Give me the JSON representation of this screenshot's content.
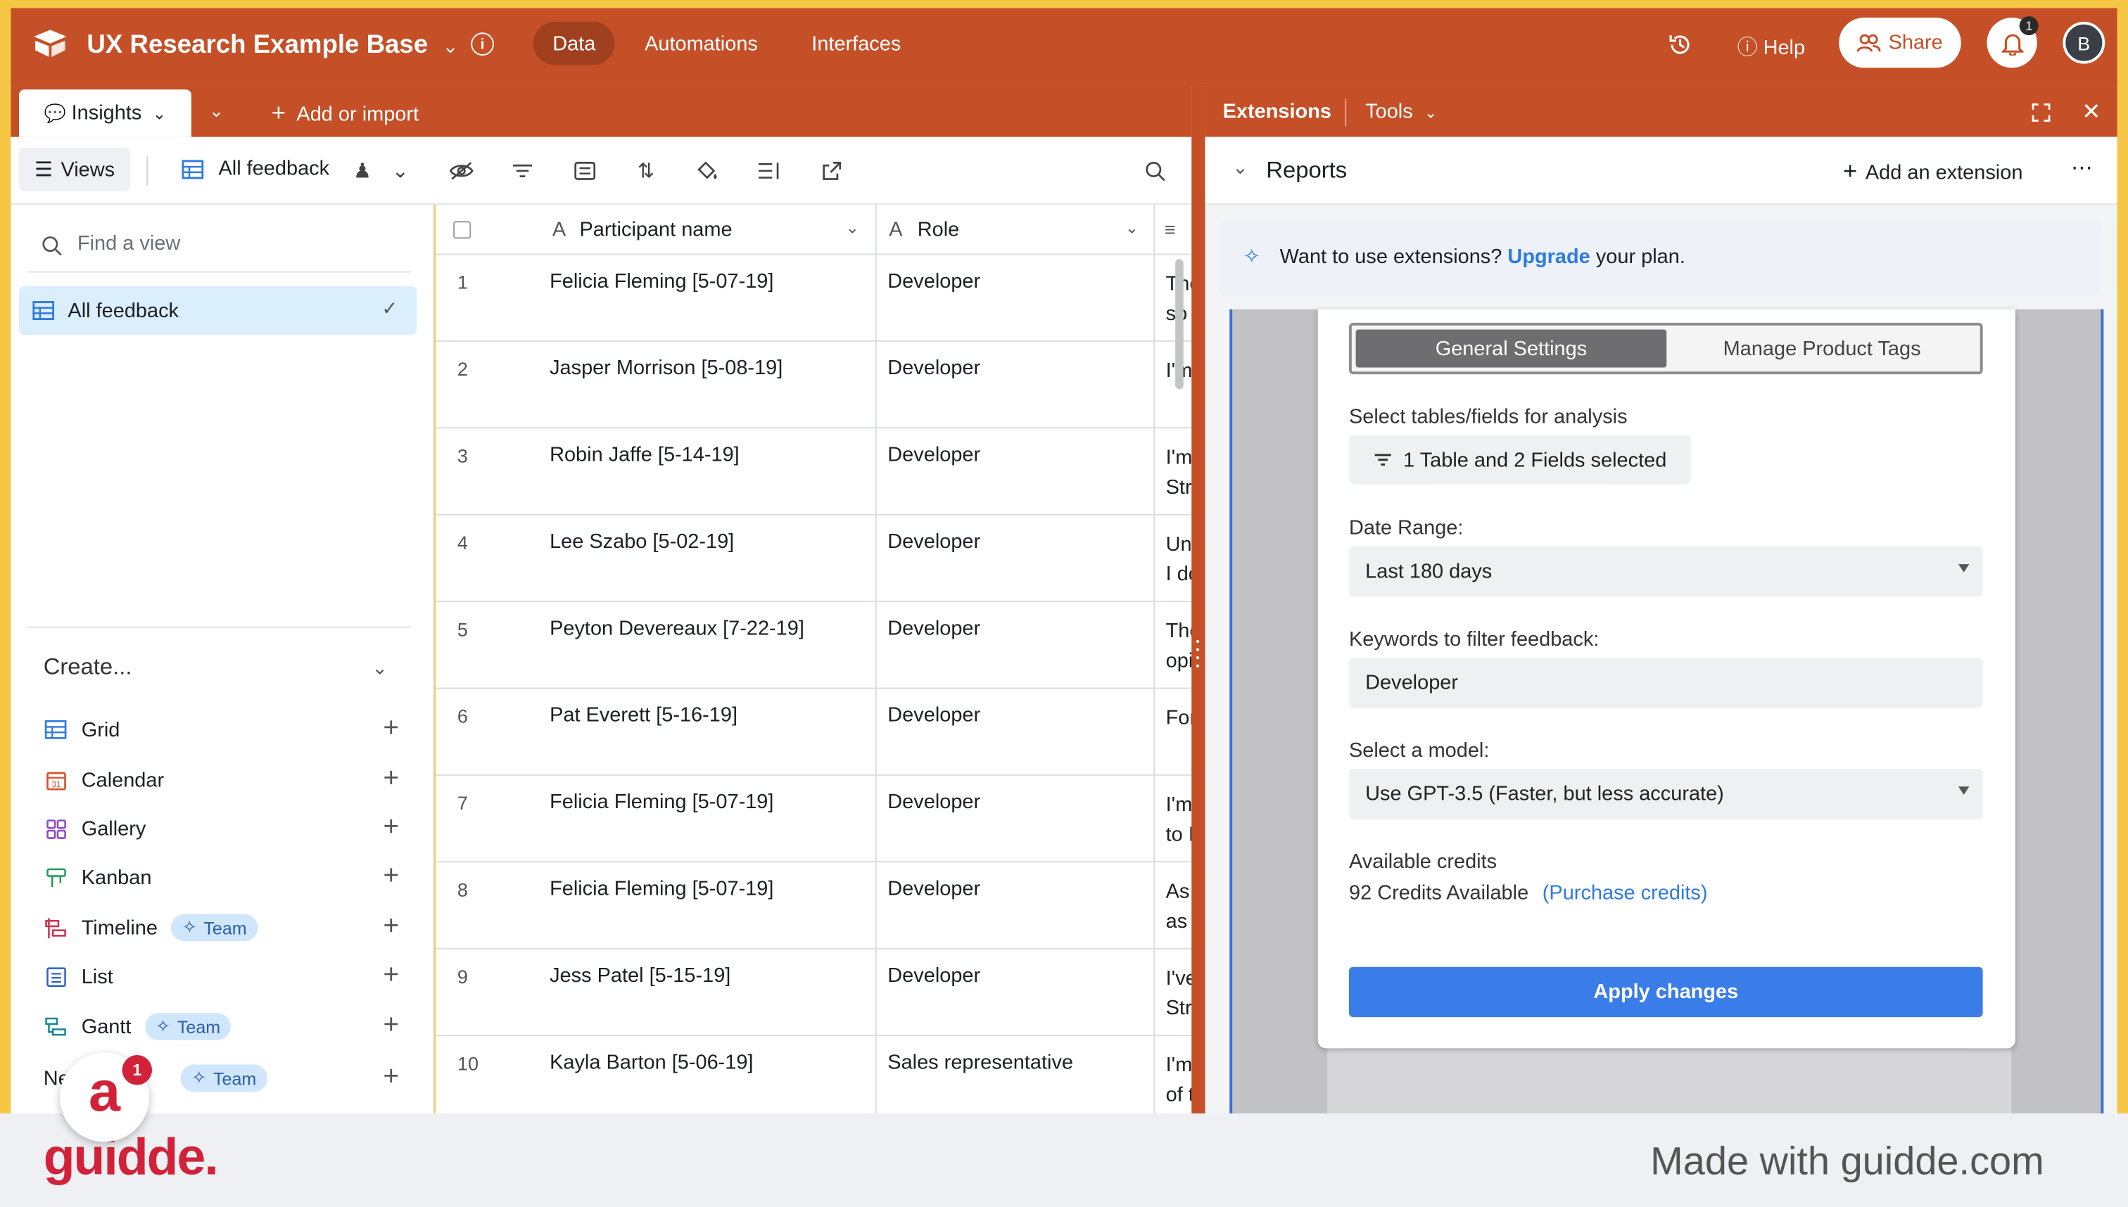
{
  "topbar": {
    "base_title": "UX Research Example Base",
    "nav": [
      "Data",
      "Automations",
      "Interfaces"
    ],
    "help_label": "Help",
    "share_label": "Share",
    "notification_count": "1",
    "avatar_initial": "B"
  },
  "tables": {
    "active_tab": "Insights",
    "add_label": "Add or import"
  },
  "viewbar": {
    "views_label": "Views",
    "view_name": "All feedback"
  },
  "sidebar": {
    "find_placeholder": "Find a view",
    "active_view": "All feedback",
    "create_label": "Create...",
    "items": [
      {
        "label": "Grid",
        "badge": ""
      },
      {
        "label": "Calendar",
        "badge": ""
      },
      {
        "label": "Gallery",
        "badge": ""
      },
      {
        "label": "Kanban",
        "badge": ""
      },
      {
        "label": "Timeline",
        "badge": "Team"
      },
      {
        "label": "List",
        "badge": ""
      },
      {
        "label": "Gantt",
        "badge": "Team"
      },
      {
        "label": "Ne",
        "badge": "Team"
      }
    ]
  },
  "grid": {
    "columns": [
      "Participant name",
      "Role"
    ],
    "rows": [
      {
        "num": "1",
        "name": "Felicia Fleming [5-07-19]",
        "role": "Developer",
        "notes": "The\nso"
      },
      {
        "num": "2",
        "name": "Jasper Morrison [5-08-19]",
        "role": "Developer",
        "notes": "I'm"
      },
      {
        "num": "3",
        "name": "Robin Jaffe [5-14-19]",
        "role": "Developer",
        "notes": "I'm\nStr"
      },
      {
        "num": "4",
        "name": "Lee Szabo [5-02-19]",
        "role": "Developer",
        "notes": "Un\nI do"
      },
      {
        "num": "5",
        "name": "Peyton Devereaux [7-22-19]",
        "role": "Developer",
        "notes": "The\nopi"
      },
      {
        "num": "6",
        "name": "Pat Everett [5-16-19]",
        "role": "Developer",
        "notes": "For"
      },
      {
        "num": "7",
        "name": "Felicia Fleming [5-07-19]",
        "role": "Developer",
        "notes": "I'm\nto I"
      },
      {
        "num": "8",
        "name": "Felicia Fleming [5-07-19]",
        "role": "Developer",
        "notes": "As\nas"
      },
      {
        "num": "9",
        "name": "Jess Patel [5-15-19]",
        "role": "Developer",
        "notes": "I've\nStr"
      },
      {
        "num": "10",
        "name": "Kayla Barton [5-06-19]",
        "role": "Sales representative",
        "notes": "I'm\nof t"
      }
    ]
  },
  "extensions": {
    "title": "Extensions",
    "tools_label": "Tools",
    "section": "Reports",
    "add_extension": "Add an extension",
    "upsell_prefix": "Want to use extensions?",
    "upsell_link": "Upgrade",
    "upsell_suffix": "your plan.",
    "settings": {
      "tab_general": "General Settings",
      "tab_tags": "Manage Product Tags",
      "select_label": "Select tables/fields for analysis",
      "select_value": "1 Table and 2 Fields selected",
      "date_label": "Date Range:",
      "date_value": "Last 180 days",
      "keywords_label": "Keywords to filter feedback:",
      "keywords_value": "Developer",
      "model_label": "Select a model:",
      "model_value": "Use GPT-3.5 (Faster, but less accurate)",
      "credits_label": "Available credits",
      "credits_value": "92 Credits Available",
      "purchase_label": "(Purchase credits)",
      "apply_label": "Apply changes"
    }
  },
  "footer": {
    "logo_text": "guidde.",
    "made_with": "Made with guidde.com",
    "bubble_letter": "a",
    "bubble_count": "1"
  },
  "colors": {
    "brand_orange": "#c54f27",
    "accent_blue": "#3b7de8",
    "guidde_red": "#d1223a"
  }
}
